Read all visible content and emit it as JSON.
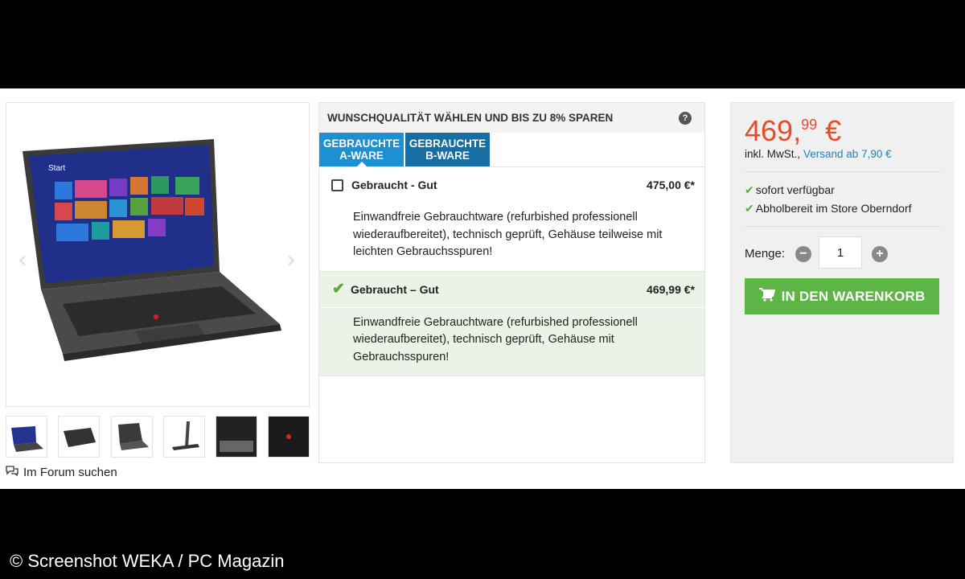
{
  "gallery": {
    "thumbnails": [
      "thumb-1",
      "thumb-2",
      "thumb-3",
      "thumb-4",
      "thumb-5",
      "thumb-6"
    ],
    "forum_link": "Im Forum suchen",
    "screen_start": "Start"
  },
  "quality": {
    "title": "WUNSCHQUALITÄT WÄHLEN UND BIS ZU 8% SPAREN",
    "help": "?",
    "tabs": [
      {
        "line1": "GEBRAUCHTE",
        "line2": "A-WARE"
      },
      {
        "line1": "GEBRAUCHTE",
        "line2": "B-WARE"
      }
    ],
    "options": [
      {
        "name": "Gebraucht - Gut",
        "price": "475,00 €*",
        "description": "Einwandfreie Gebrauchtware (refurbished professionell wiederaufbereitet), technisch geprüft, Gehäuse teilweise mit leichten Gebrauchsspuren!"
      },
      {
        "name": "Gebraucht – Gut",
        "price": "469,99 €*",
        "description": "Einwandfreie Gebrauchtware (refurbished professionell wiederaufbereitet), technisch geprüft, Gehäuse mit Gebrauchsspuren!"
      }
    ]
  },
  "price_box": {
    "price_main": "469,",
    "price_cents": "99",
    "currency": " €",
    "vat_label": "inkl. MwSt.,",
    "shipping_link": "Versand ab 7,90 €",
    "availability": [
      "sofort verfügbar",
      "Abholbereit im Store Oberndorf"
    ],
    "quantity_label": "Menge:",
    "quantity_value": "1",
    "cart_button": "IN DEN WARENKORB"
  },
  "colors": {
    "price": "#e74c2a",
    "tab_blue": "#1a85c2",
    "cart_green": "#5cb545",
    "selected_bg": "#eaf3e5"
  },
  "footer": {
    "copyright": "© Screenshot WEKA / PC Magazin"
  }
}
